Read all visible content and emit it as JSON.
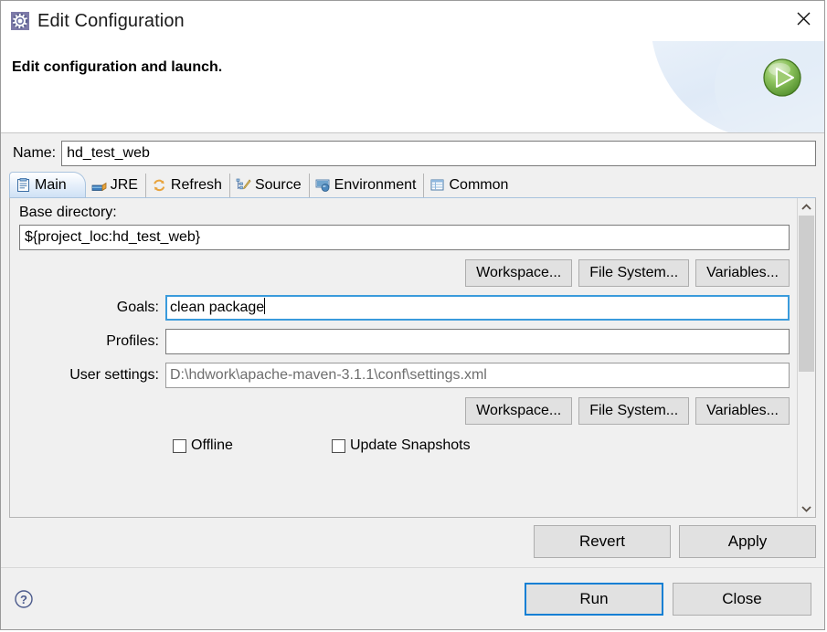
{
  "window": {
    "title": "Edit Configuration",
    "icon": "gear-configuration-icon",
    "close_label": "✕"
  },
  "header": {
    "message": "Edit configuration and launch.",
    "badge_icon": "green-run-play-icon"
  },
  "name_field": {
    "label": "Name:",
    "value": "hd_test_web"
  },
  "tabs": [
    {
      "label": "Main",
      "icon": "main-document-icon",
      "selected": true
    },
    {
      "label": "JRE",
      "icon": "jre-library-icon",
      "selected": false
    },
    {
      "label": "Refresh",
      "icon": "refresh-arrows-icon",
      "selected": false
    },
    {
      "label": "Source",
      "icon": "source-edit-icon",
      "selected": false
    },
    {
      "label": "Environment",
      "icon": "environment-icon",
      "selected": false
    },
    {
      "label": "Common",
      "icon": "common-table-icon",
      "selected": false
    }
  ],
  "main_tab": {
    "base_directory": {
      "label": "Base directory:",
      "value": "${project_loc:hd_test_web}"
    },
    "base_dir_buttons": [
      {
        "label": "Workspace..."
      },
      {
        "label": "File System..."
      },
      {
        "label": "Variables..."
      }
    ],
    "goals": {
      "label": "Goals:",
      "value": "clean package",
      "focused": true
    },
    "profiles": {
      "label": "Profiles:",
      "value": ""
    },
    "user_settings": {
      "label": "User settings:",
      "value": "D:\\hdwork\\apache-maven-3.1.1\\conf\\settings.xml",
      "muted": true
    },
    "user_settings_buttons": [
      {
        "label": "Workspace..."
      },
      {
        "label": "File System..."
      },
      {
        "label": "Variables..."
      }
    ],
    "checkboxes": [
      {
        "label": "Offline",
        "checked": false
      },
      {
        "label": "Update Snapshots",
        "checked": false
      }
    ]
  },
  "apply_bar": {
    "revert": "Revert",
    "apply": "Apply"
  },
  "footer": {
    "help_icon": "help-question-icon",
    "run": "Run",
    "close": "Close"
  },
  "colors": {
    "dialog_bg": "#f0f0f0",
    "accent_focus": "#0f7fd4",
    "tab_selected": "#cfe1f5",
    "muted_text": "#6e6e6e",
    "run_green": "#6aaa3c"
  }
}
